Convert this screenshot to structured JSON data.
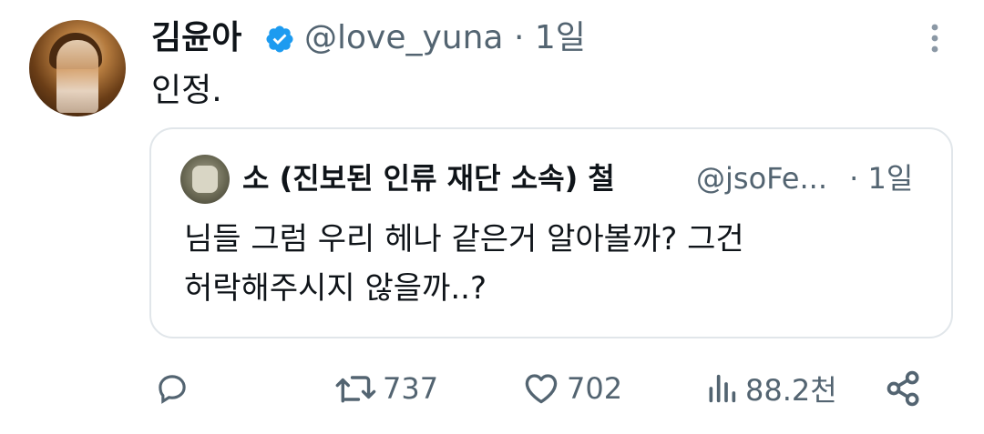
{
  "tweet": {
    "author_name": "김윤아",
    "handle": "@love_yuna",
    "separator": "·",
    "time": "1일",
    "text": "인정."
  },
  "quoted": {
    "author_name": "소 (진보된 인류 재단 소속) 철",
    "handle": "@jsoFe...",
    "separator": "·",
    "time": "1일",
    "text_line1": "님들 그럼 우리 헤나 같은거 알아볼까? 그건",
    "text_line2": "허락해주시지 않을까..?"
  },
  "actions": {
    "reply_count": "",
    "retweet_count": "737",
    "like_count": "702",
    "views_count": "88.2천"
  },
  "colors": {
    "verified": "#1d9bf0",
    "muted": "#536471",
    "border": "#e1e6ea"
  },
  "icons": [
    "verified-badge-icon",
    "more-options-icon",
    "reply-icon",
    "retweet-icon",
    "like-icon",
    "views-icon",
    "share-icon"
  ]
}
